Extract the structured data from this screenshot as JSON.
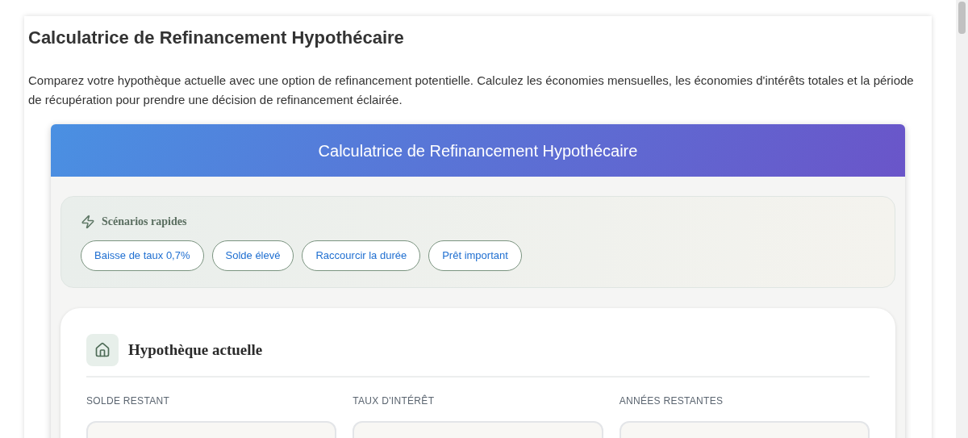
{
  "page": {
    "title": "Calculatrice de Refinancement Hypothécaire",
    "intro": "Comparez votre hypothèque actuelle avec une option de refinancement potentielle. Calculez les économies mensuelles, les économies d'intérêts totales et la période de récupération pour prendre une décision de refinancement éclairée."
  },
  "calculator": {
    "header": "Calculatrice de Refinancement Hypothécaire",
    "scenarios": {
      "title": "Scénarios rapides",
      "buttons": [
        "Baisse de taux 0,7%",
        "Solde élevé",
        "Raccourcir la durée",
        "Prêt important"
      ]
    },
    "section": {
      "title": "Hypothèque actuelle",
      "fields": [
        {
          "label": "SOLDE RESTANT"
        },
        {
          "label": "TAUX D'INTÉRÊT"
        },
        {
          "label": "ANNÉES RESTANTES"
        }
      ]
    }
  }
}
